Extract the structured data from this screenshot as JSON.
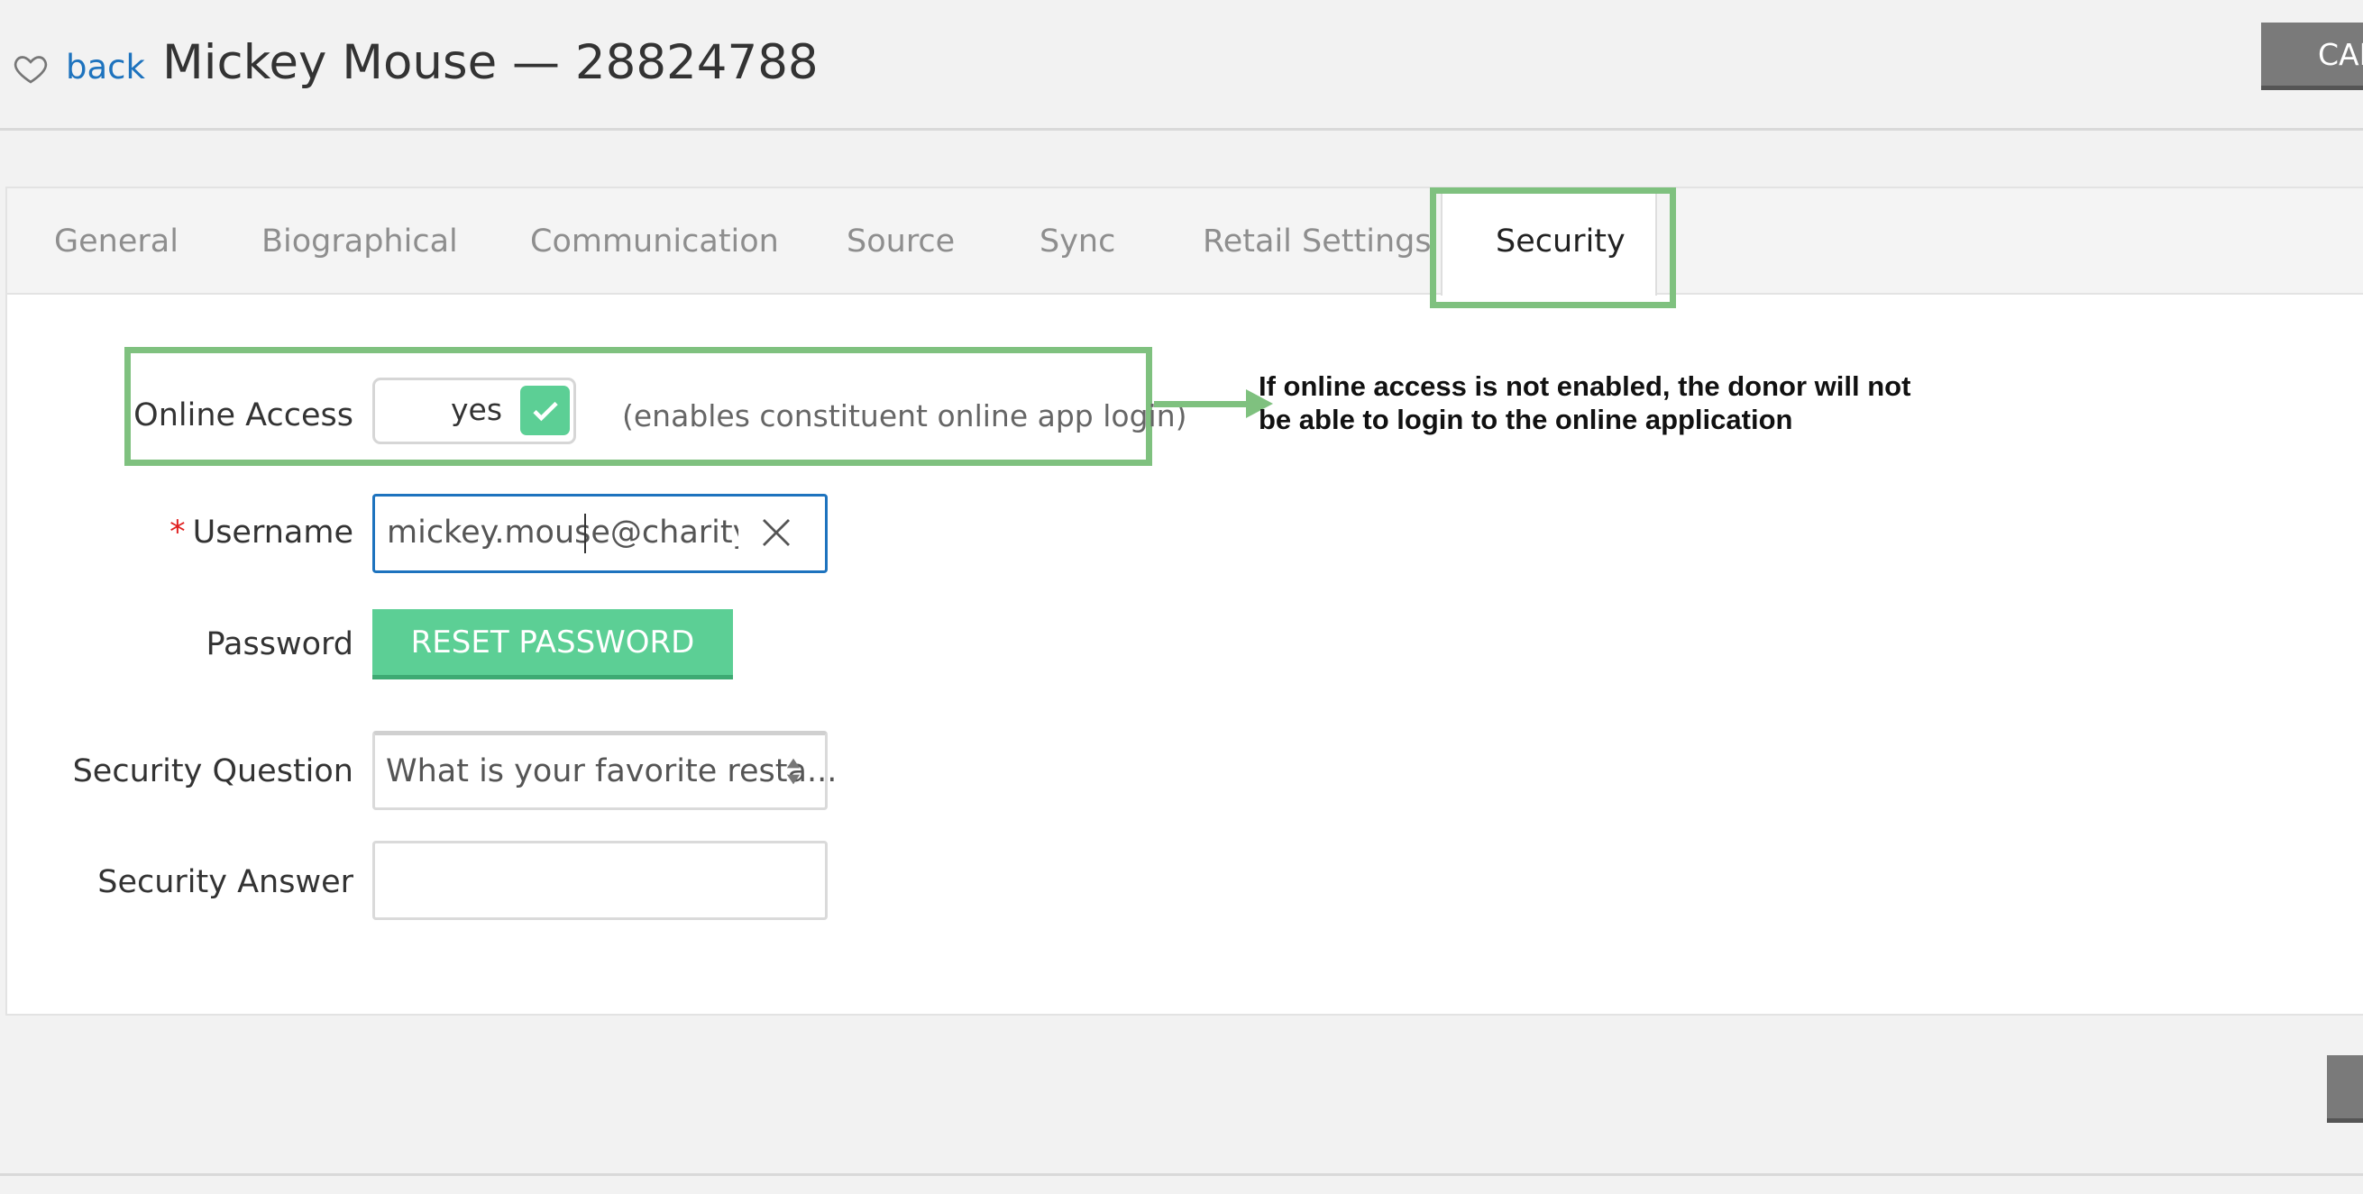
{
  "header": {
    "back_label": "back",
    "title": "Mickey Mouse — 28824788",
    "cancel_label": "CAN"
  },
  "tabs": [
    {
      "label": "General"
    },
    {
      "label": "Biographical"
    },
    {
      "label": "Communication"
    },
    {
      "label": "Source"
    },
    {
      "label": "Sync"
    },
    {
      "label": "Retail Settings"
    },
    {
      "label": "Security",
      "active": true
    }
  ],
  "form": {
    "online_access": {
      "label": "Online Access",
      "toggle_value": "yes",
      "hint": "(enables constituent online app login)"
    },
    "annotation": {
      "line1": "If online access is not enabled, the donor will not",
      "line2": "be able to login to the online application"
    },
    "username": {
      "required_mark": "*",
      "label": "Username",
      "value": "mickey.mouse@charityen"
    },
    "password": {
      "label": "Password",
      "button_label": "RESET PASSWORD"
    },
    "security_question": {
      "label": "Security Question",
      "selected": "What is your favorite resta..."
    },
    "security_answer": {
      "label": "Security Answer",
      "value": ""
    }
  },
  "icons": {
    "favorite": "heart-outline-icon",
    "clear": "close-icon",
    "toggle_check": "check-icon",
    "select": "sort-arrows-icon"
  },
  "colors": {
    "link": "#1e73be",
    "accent_green": "#5ccf95",
    "highlight_green": "#7fc17f",
    "required": "#e02020"
  }
}
